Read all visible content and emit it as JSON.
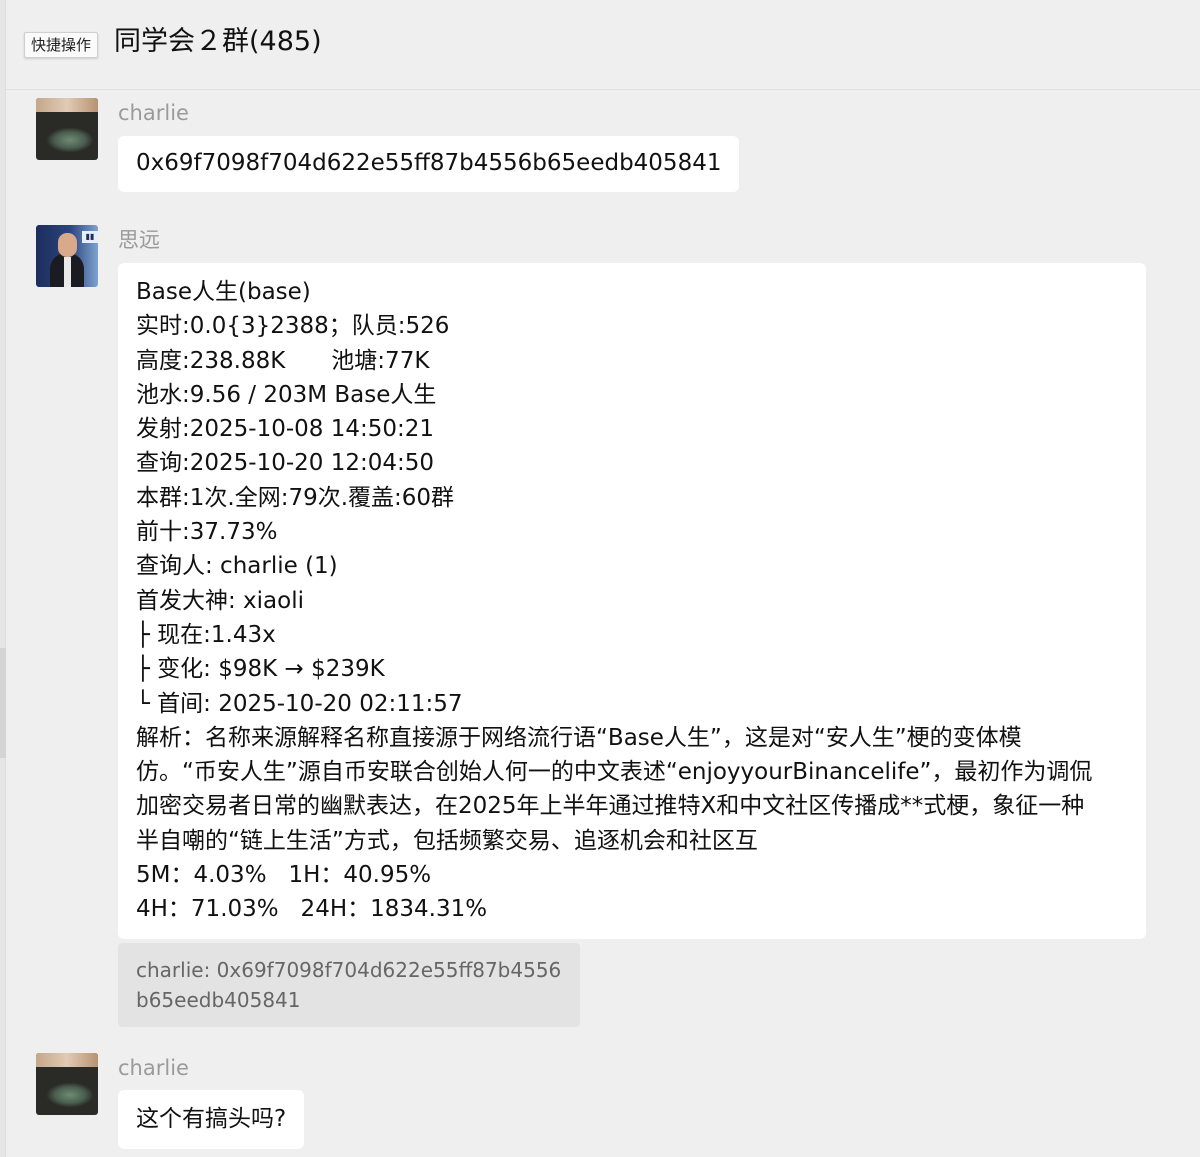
{
  "header": {
    "quick_ops_label": "快捷操作",
    "group_title": "同学会２群(485)"
  },
  "messages": [
    {
      "sender": "charlie",
      "avatar": "bowl-photo-avatar",
      "text": "0x69f7098f704d622e55ff87b4556b65eedb405841"
    },
    {
      "sender": "思远",
      "avatar": "man-speaker-avatar",
      "lines": [
        "Base人生(base)",
        "实时:0.0{3}2388；队员:526",
        "高度:238.88K　　池塘:77K",
        "池水:9.56 / 203M Base人生",
        "发射:2025-10-08 14:50:21",
        "查询:2025-10-20 12:04:50",
        "本群:1次.全网:79次.覆盖:60群",
        "前十:37.73%",
        "查询人: charlie (1)",
        "首发大神: xiaoli",
        "├ 现在:1.43x",
        "├ 变化: $98K → $239K",
        "└ 首间: 2025-10-20 02:11:57"
      ],
      "analysis": [
        "解析：名称来源解释名称直接源于网络流行语“Base人生”，这是对“安人生”梗的变体模",
        "仿。“币安人生”源自币安联合创始人何一的中文表述“enjoyyourBinancelife”，最初作为调侃",
        "加密交易者日常的幽默表达，在2025年上半年通过推特X和中文社区传播成**式梗，象征一种",
        "半自嘲的“链上生活”方式，包括频繁交易、追逐机会和社区互"
      ],
      "stats": [
        "5M：4.03%   1H：40.95%",
        "4H：71.03%   24H：1834.31%"
      ],
      "quote": [
        "charlie: 0x69f7098f704d622e55ff87b4556",
        "b65eedb405841"
      ]
    },
    {
      "sender": "charlie",
      "avatar": "bowl-photo-avatar",
      "text": "这个有搞头吗?"
    }
  ]
}
